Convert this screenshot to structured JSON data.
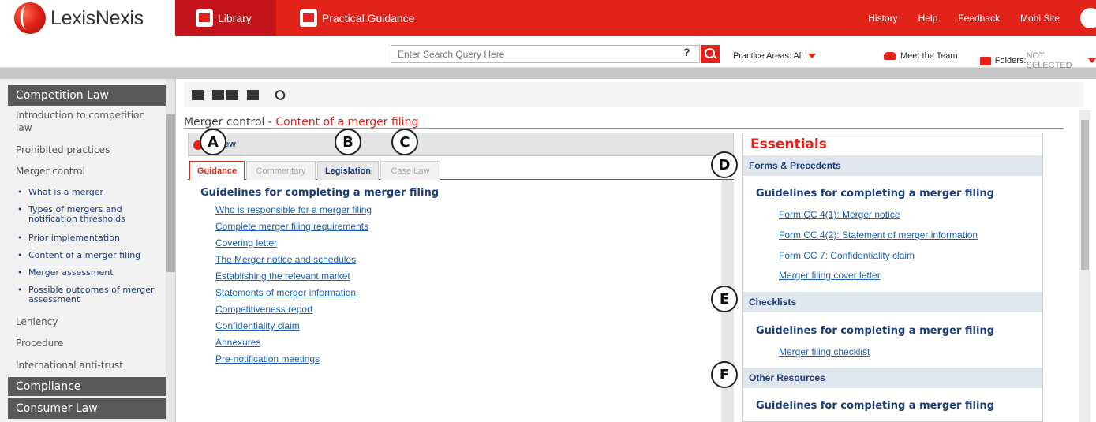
{
  "brand": {
    "logo_text": "LexisNexis",
    "accent": "#e2231a"
  },
  "top_tabs": [
    {
      "label": "Library",
      "icon": "book-icon"
    },
    {
      "label": "Practical Guidance",
      "icon": "document-icon"
    }
  ],
  "top_links": [
    "History",
    "Help",
    "Feedback",
    "Mobi Site"
  ],
  "search": {
    "placeholder": "Enter Search Query Here",
    "help": "?"
  },
  "search_row": {
    "practice_areas": "Practice Areas: All",
    "meet_team": "Meet the Team",
    "folders_label": "Folders:",
    "folders_value": "NOT SELECTED"
  },
  "sidebar": {
    "sections": [
      "Competition Law",
      "Compliance",
      "Consumer Law"
    ],
    "items": [
      "Introduction to competition law",
      "Prohibited practices",
      "Merger control",
      "Leniency",
      "Procedure",
      "International anti-trust"
    ],
    "subitems": [
      "What is a merger",
      "Types of mergers and notification thresholds",
      "Prior implementation",
      "Content of a merger filing",
      "Merger assessment",
      "Possible outcomes of merger assessment"
    ]
  },
  "heading": {
    "prefix": "Merger control -",
    "current": "Content of a merger filing"
  },
  "overview_label": "view",
  "tabs": [
    "Guidance",
    "Commentary",
    "Legislation",
    "Case Law"
  ],
  "guidance": {
    "heading": "Guidelines for completing a merger filing",
    "links": [
      "Who is responsible for a merger filing",
      "Complete merger filing requirements",
      "Covering letter",
      "The Merger notice and schedules",
      "Establishing the relevant market",
      "Statements of merger information",
      "Competitiveness report",
      "Confidentiality claim",
      "Annexures",
      "Pre-notification meetings"
    ]
  },
  "essentials": {
    "title": "Essentials",
    "sections": [
      {
        "label": "Forms & Precedents",
        "heading": "Guidelines for completing a merger filing",
        "links": [
          "Form CC 4(1): Merger notice",
          "Form CC 4(2): Statement of merger information",
          "Form CC 7: Confidentiality claim",
          "Merger filing cover letter"
        ]
      },
      {
        "label": "Checklists",
        "heading": "Guidelines for completing a merger filing",
        "links": [
          "Merger filing checklist"
        ]
      },
      {
        "label": "Other Resources",
        "heading": "Guidelines for completing a merger filing",
        "links": []
      }
    ]
  },
  "callouts": [
    "A",
    "B",
    "C",
    "D",
    "E",
    "F"
  ]
}
